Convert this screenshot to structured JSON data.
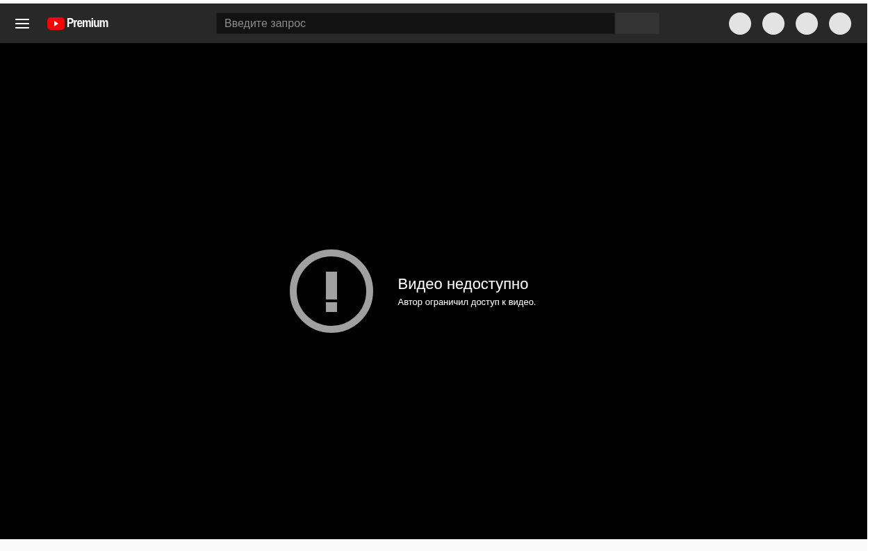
{
  "header": {
    "logo_text": "Premium",
    "search": {
      "placeholder": "Введите запрос"
    }
  },
  "player": {
    "error": {
      "title": "Видео недоступно",
      "message": "Автор ограничил доступ к видео."
    }
  }
}
